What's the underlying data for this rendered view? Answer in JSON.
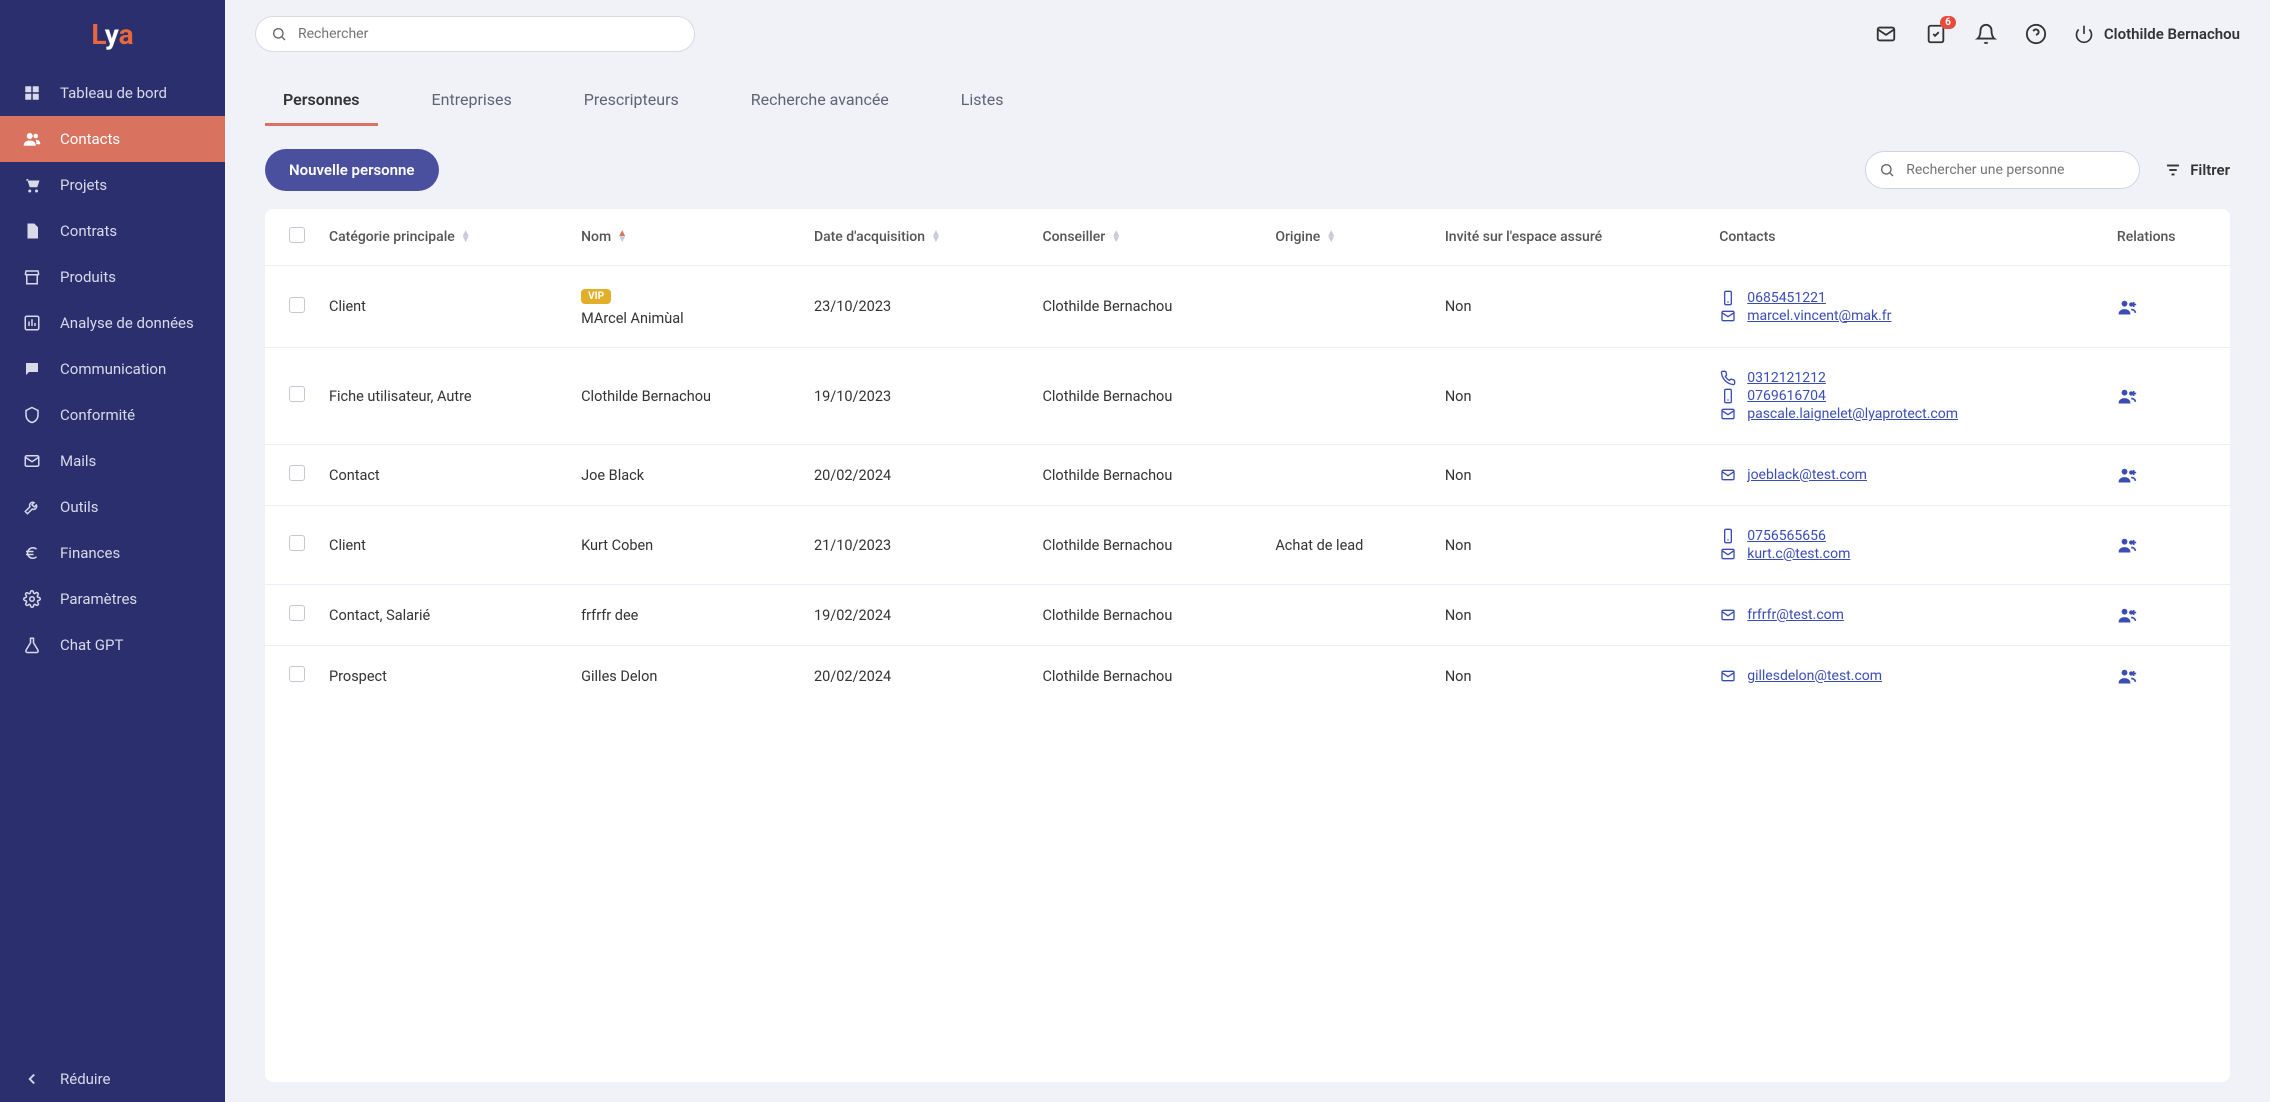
{
  "logo": {
    "parts": [
      "L",
      "y",
      "a"
    ]
  },
  "sidebar": {
    "items": [
      {
        "label": "Tableau de bord",
        "icon": "dashboard"
      },
      {
        "label": "Contacts",
        "icon": "people",
        "active": true
      },
      {
        "label": "Projets",
        "icon": "cart"
      },
      {
        "label": "Contrats",
        "icon": "file"
      },
      {
        "label": "Produits",
        "icon": "store"
      },
      {
        "label": "Analyse de données",
        "icon": "chart"
      },
      {
        "label": "Communication",
        "icon": "chat"
      },
      {
        "label": "Conformité",
        "icon": "shield"
      },
      {
        "label": "Mails",
        "icon": "mail"
      },
      {
        "label": "Outils",
        "icon": "tools"
      },
      {
        "label": "Finances",
        "icon": "euro"
      },
      {
        "label": "Paramètres",
        "icon": "gear"
      },
      {
        "label": "Chat GPT",
        "icon": "flask"
      }
    ],
    "collapse": "Réduire"
  },
  "topbar": {
    "search_placeholder": "Rechercher",
    "badge_count": "6",
    "user_name": "Clothilde Bernachou"
  },
  "tabs": [
    {
      "label": "Personnes",
      "active": true
    },
    {
      "label": "Entreprises"
    },
    {
      "label": "Prescripteurs"
    },
    {
      "label": "Recherche avancée"
    },
    {
      "label": "Listes"
    }
  ],
  "actions": {
    "new_person": "Nouvelle personne",
    "person_search_placeholder": "Rechercher une personne",
    "filter": "Filtrer"
  },
  "table": {
    "headers": {
      "category": "Catégorie principale",
      "name": "Nom",
      "acq_date": "Date d'acquisition",
      "advisor": "Conseiller",
      "origin": "Origine",
      "invited": "Invité sur l'espace assuré",
      "contacts": "Contacts",
      "relations": "Relations"
    },
    "rows": [
      {
        "category": "Client",
        "vip": true,
        "name": "MArcel Animùal",
        "date": "23/10/2023",
        "advisor": "Clothilde Bernachou",
        "origin": "",
        "invited": "Non",
        "contacts": [
          {
            "type": "mobile",
            "value": "0685451221"
          },
          {
            "type": "mail",
            "value": "marcel.vincent@mak.fr"
          }
        ]
      },
      {
        "category": "Fiche utilisateur, Autre",
        "name": "Clothilde Bernachou",
        "date": "19/10/2023",
        "advisor": "Clothilde Bernachou",
        "origin": "",
        "invited": "Non",
        "contacts": [
          {
            "type": "phone",
            "value": "0312121212"
          },
          {
            "type": "mobile",
            "value": "0769616704"
          },
          {
            "type": "mail",
            "value": "pascale.laignelet@lyaprotect.com"
          }
        ]
      },
      {
        "category": "Contact",
        "name": "Joe Black",
        "date": "20/02/2024",
        "advisor": "Clothilde Bernachou",
        "origin": "",
        "invited": "Non",
        "contacts": [
          {
            "type": "mail",
            "value": "joeblack@test.com"
          }
        ]
      },
      {
        "category": "Client",
        "name": "Kurt Coben",
        "date": "21/10/2023",
        "advisor": "Clothilde Bernachou",
        "origin": "Achat de lead",
        "invited": "Non",
        "contacts": [
          {
            "type": "mobile",
            "value": "0756565656"
          },
          {
            "type": "mail",
            "value": "kurt.c@test.com"
          }
        ]
      },
      {
        "category": "Contact, Salarié",
        "name": "frfrfr dee",
        "date": "19/02/2024",
        "advisor": "Clothilde Bernachou",
        "origin": "",
        "invited": "Non",
        "contacts": [
          {
            "type": "mail",
            "value": "frfrfr@test.com"
          }
        ]
      },
      {
        "category": "Prospect",
        "name": "Gilles Delon",
        "date": "20/02/2024",
        "advisor": "Clothilde Bernachou",
        "origin": "",
        "invited": "Non",
        "contacts": [
          {
            "type": "mail",
            "value": "gillesdelon@test.com"
          }
        ]
      }
    ],
    "vip_label": "VIP"
  }
}
